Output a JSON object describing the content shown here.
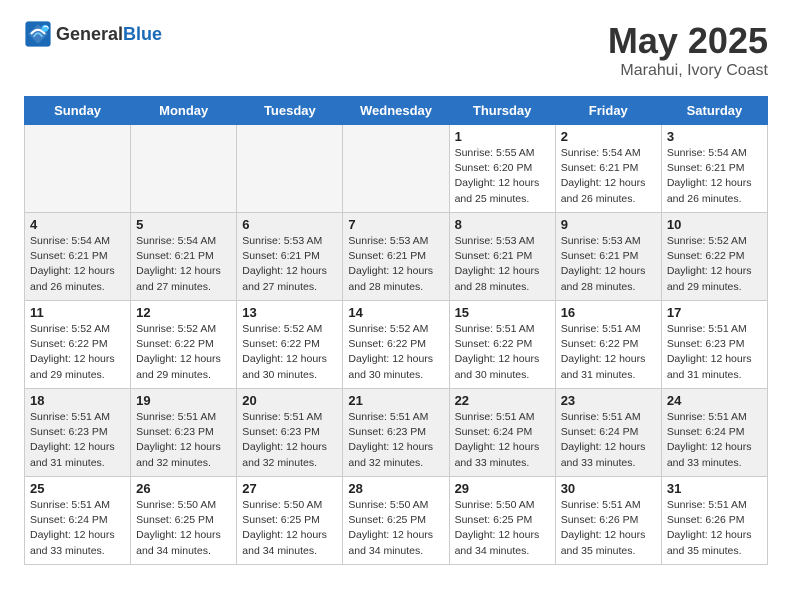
{
  "header": {
    "logo_general": "General",
    "logo_blue": "Blue",
    "title": "May 2025",
    "subtitle": "Marahui, Ivory Coast"
  },
  "days_of_week": [
    "Sunday",
    "Monday",
    "Tuesday",
    "Wednesday",
    "Thursday",
    "Friday",
    "Saturday"
  ],
  "weeks": [
    [
      {
        "day": "",
        "info": "",
        "empty": true
      },
      {
        "day": "",
        "info": "",
        "empty": true
      },
      {
        "day": "",
        "info": "",
        "empty": true
      },
      {
        "day": "",
        "info": "",
        "empty": true
      },
      {
        "day": "1",
        "info": "Sunrise: 5:55 AM\nSunset: 6:20 PM\nDaylight: 12 hours\nand 25 minutes."
      },
      {
        "day": "2",
        "info": "Sunrise: 5:54 AM\nSunset: 6:21 PM\nDaylight: 12 hours\nand 26 minutes."
      },
      {
        "day": "3",
        "info": "Sunrise: 5:54 AM\nSunset: 6:21 PM\nDaylight: 12 hours\nand 26 minutes."
      }
    ],
    [
      {
        "day": "4",
        "info": "Sunrise: 5:54 AM\nSunset: 6:21 PM\nDaylight: 12 hours\nand 26 minutes."
      },
      {
        "day": "5",
        "info": "Sunrise: 5:54 AM\nSunset: 6:21 PM\nDaylight: 12 hours\nand 27 minutes."
      },
      {
        "day": "6",
        "info": "Sunrise: 5:53 AM\nSunset: 6:21 PM\nDaylight: 12 hours\nand 27 minutes."
      },
      {
        "day": "7",
        "info": "Sunrise: 5:53 AM\nSunset: 6:21 PM\nDaylight: 12 hours\nand 28 minutes."
      },
      {
        "day": "8",
        "info": "Sunrise: 5:53 AM\nSunset: 6:21 PM\nDaylight: 12 hours\nand 28 minutes."
      },
      {
        "day": "9",
        "info": "Sunrise: 5:53 AM\nSunset: 6:21 PM\nDaylight: 12 hours\nand 28 minutes."
      },
      {
        "day": "10",
        "info": "Sunrise: 5:52 AM\nSunset: 6:22 PM\nDaylight: 12 hours\nand 29 minutes."
      }
    ],
    [
      {
        "day": "11",
        "info": "Sunrise: 5:52 AM\nSunset: 6:22 PM\nDaylight: 12 hours\nand 29 minutes."
      },
      {
        "day": "12",
        "info": "Sunrise: 5:52 AM\nSunset: 6:22 PM\nDaylight: 12 hours\nand 29 minutes."
      },
      {
        "day": "13",
        "info": "Sunrise: 5:52 AM\nSunset: 6:22 PM\nDaylight: 12 hours\nand 30 minutes."
      },
      {
        "day": "14",
        "info": "Sunrise: 5:52 AM\nSunset: 6:22 PM\nDaylight: 12 hours\nand 30 minutes."
      },
      {
        "day": "15",
        "info": "Sunrise: 5:51 AM\nSunset: 6:22 PM\nDaylight: 12 hours\nand 30 minutes."
      },
      {
        "day": "16",
        "info": "Sunrise: 5:51 AM\nSunset: 6:22 PM\nDaylight: 12 hours\nand 31 minutes."
      },
      {
        "day": "17",
        "info": "Sunrise: 5:51 AM\nSunset: 6:23 PM\nDaylight: 12 hours\nand 31 minutes."
      }
    ],
    [
      {
        "day": "18",
        "info": "Sunrise: 5:51 AM\nSunset: 6:23 PM\nDaylight: 12 hours\nand 31 minutes."
      },
      {
        "day": "19",
        "info": "Sunrise: 5:51 AM\nSunset: 6:23 PM\nDaylight: 12 hours\nand 32 minutes."
      },
      {
        "day": "20",
        "info": "Sunrise: 5:51 AM\nSunset: 6:23 PM\nDaylight: 12 hours\nand 32 minutes."
      },
      {
        "day": "21",
        "info": "Sunrise: 5:51 AM\nSunset: 6:23 PM\nDaylight: 12 hours\nand 32 minutes."
      },
      {
        "day": "22",
        "info": "Sunrise: 5:51 AM\nSunset: 6:24 PM\nDaylight: 12 hours\nand 33 minutes."
      },
      {
        "day": "23",
        "info": "Sunrise: 5:51 AM\nSunset: 6:24 PM\nDaylight: 12 hours\nand 33 minutes."
      },
      {
        "day": "24",
        "info": "Sunrise: 5:51 AM\nSunset: 6:24 PM\nDaylight: 12 hours\nand 33 minutes."
      }
    ],
    [
      {
        "day": "25",
        "info": "Sunrise: 5:51 AM\nSunset: 6:24 PM\nDaylight: 12 hours\nand 33 minutes."
      },
      {
        "day": "26",
        "info": "Sunrise: 5:50 AM\nSunset: 6:25 PM\nDaylight: 12 hours\nand 34 minutes."
      },
      {
        "day": "27",
        "info": "Sunrise: 5:50 AM\nSunset: 6:25 PM\nDaylight: 12 hours\nand 34 minutes."
      },
      {
        "day": "28",
        "info": "Sunrise: 5:50 AM\nSunset: 6:25 PM\nDaylight: 12 hours\nand 34 minutes."
      },
      {
        "day": "29",
        "info": "Sunrise: 5:50 AM\nSunset: 6:25 PM\nDaylight: 12 hours\nand 34 minutes."
      },
      {
        "day": "30",
        "info": "Sunrise: 5:51 AM\nSunset: 6:26 PM\nDaylight: 12 hours\nand 35 minutes."
      },
      {
        "day": "31",
        "info": "Sunrise: 5:51 AM\nSunset: 6:26 PM\nDaylight: 12 hours\nand 35 minutes."
      }
    ]
  ]
}
